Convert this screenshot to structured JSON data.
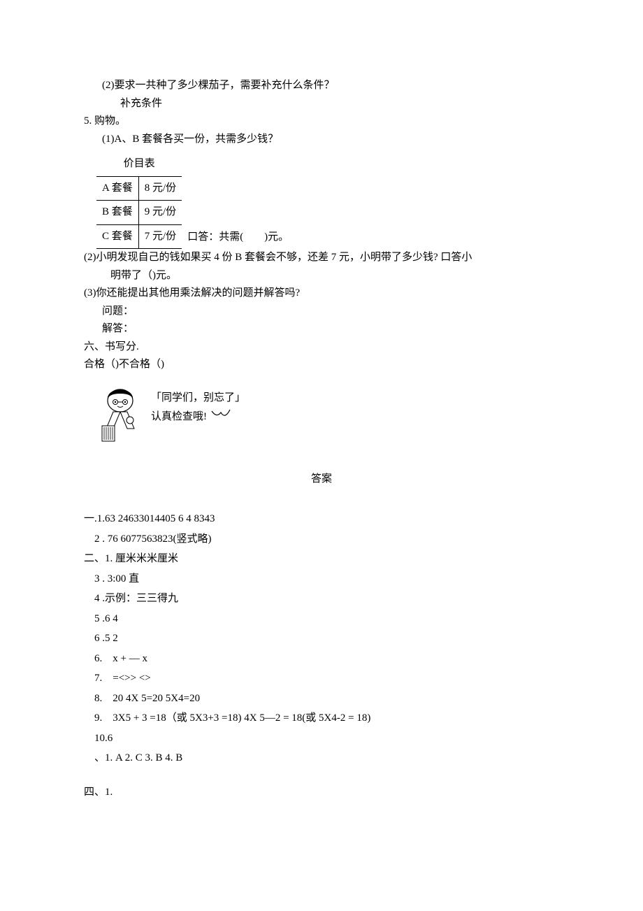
{
  "q4_2_line1": "(2)要求一共种了多少棵茄子，需要补充什么条件？",
  "q4_2_line2": "补充条件",
  "q5_title": "5. 购物。",
  "q5_1_line": "(1)A、B 套餐各买一份，共需多少钱？",
  "price_title": "价目表",
  "price_rows": [
    {
      "name": "A 套餐",
      "value": "8 元/份"
    },
    {
      "name": "B 套餐",
      "value": "9 元/份"
    },
    {
      "name": "C 套餐",
      "value": "7 元/份"
    }
  ],
  "q5_1_caption": "口答：共需(  )元。",
  "q5_2_a": "(2)小明发现自己的钱如果买 4 份 B 套餐会不够，还差 7 元，小明带了多少钱? 口答小",
  "q5_2_b": "明带了（)元。",
  "q5_3_a": "(3)你还能提出其他用乘法解决的问题并解答吗?",
  "q5_3_b": "问题：",
  "q5_3_c": "解答：",
  "sec6_a": "六、书写分.",
  "sec6_b": "合格（)不合格（)",
  "bubble1": "「同学们，别忘了」",
  "bubble2": "认真检查哦!",
  "answers_title": "答案",
  "ans_lines": [
    "一.1.63 24633014405 6 4 8343",
    " 2 . 76 6077563823(竖式略)",
    "二、1. 厘米米米厘米",
    " 3 . 3:00 直",
    " 4 .示例：三三得九",
    " 5 .6 4",
    " 6 .5 2",
    " 6. x + — x",
    " 7. =<>> <>",
    " 8. 20 4X 5=20 5X4=20",
    " 9. 3X5 + 3 =18（或 5X3+3 =18) 4X 5—2 = 18(或 5X4-2 = 18)",
    " 10.6",
    " 、1. A 2. C 3. B 4. B",
    "",
    "四、1."
  ]
}
